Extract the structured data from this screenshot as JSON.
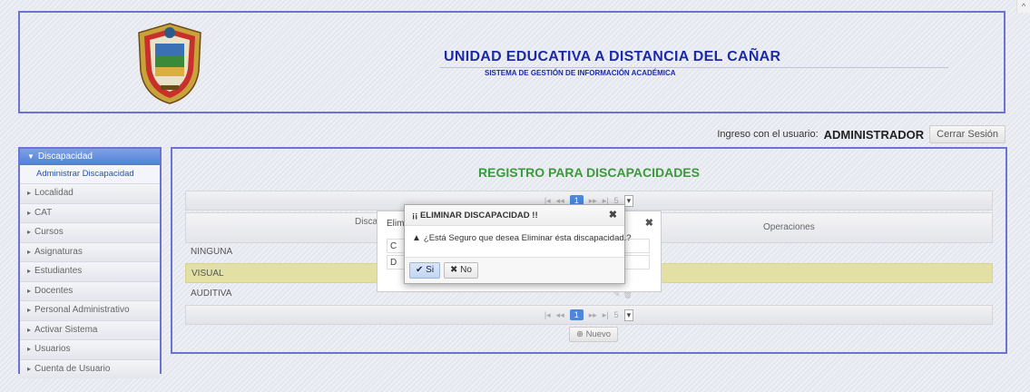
{
  "header": {
    "title": "UNIDAD EDUCATIVA A DISTANCIA DEL CAÑAR",
    "subtitle": "SISTEMA DE GESTIÓN DE INFORMACIÓN ACADÉMICA",
    "logo_icon": "school-crest-icon"
  },
  "userbar": {
    "label": "Ingreso con el usuario:",
    "username": "ADMINISTRADOR",
    "logout_label": "Cerrar Sesión"
  },
  "sidebar": {
    "active": "Discapacidad",
    "active_sub": "Administrar Discapacidad",
    "items": [
      "Localidad",
      "CAT",
      "Cursos",
      "Asignaturas",
      "Estudiantes",
      "Docentes",
      "Personal Administrativo",
      "Activar Sistema",
      "Usuarios",
      "Cuenta de Usuario"
    ]
  },
  "main": {
    "title": "REGISTRO PARA DISCAPACIDADES",
    "pager_top": {
      "current": "1",
      "page_size": "5"
    },
    "pager_bottom": {
      "current": "1",
      "page_size": "5"
    },
    "columns": {
      "col1": "Disca",
      "col2": "Operaciones"
    },
    "rows": [
      "NINGUNA",
      "VISUAL",
      "AUDITIVA"
    ],
    "new_button": "Nuevo"
  },
  "background_dialog": {
    "title": "Elim",
    "field1": "C",
    "field2": "D"
  },
  "modal": {
    "title": "¡¡ ELIMINAR DISCAPACIDAD !!",
    "message": "¿Está Seguro que desea Eliminar ésta discapacidad.?",
    "yes_label": "Si",
    "no_label": "No"
  },
  "colors": {
    "frame_border": "#6b74d6",
    "title_blue": "#1c2aa8",
    "title_green": "#3a9b3a",
    "selected_row": "#e3e0a4"
  }
}
